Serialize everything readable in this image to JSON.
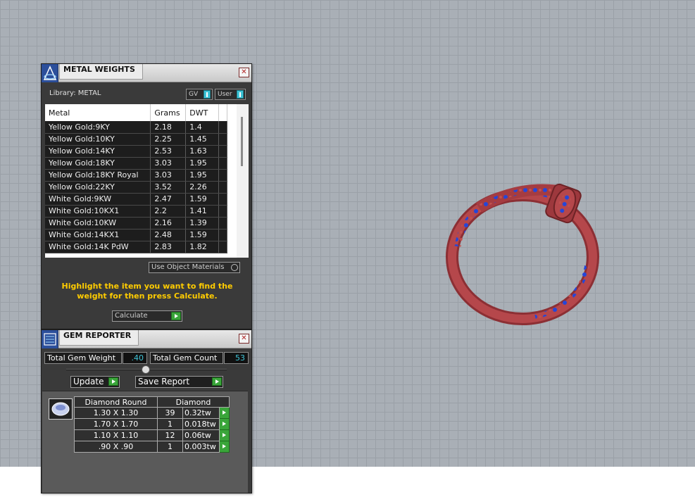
{
  "metal_panel": {
    "title": "METAL WEIGHTS",
    "library_label": "Library: METAL",
    "toggle_gv": "GV",
    "toggle_user": "User",
    "columns": [
      "Metal",
      "Grams",
      "DWT"
    ],
    "rows": [
      [
        "Yellow Gold:9KY",
        "2.18",
        "1.4"
      ],
      [
        "Yellow Gold:10KY",
        "2.25",
        "1.45"
      ],
      [
        "Yellow Gold:14KY",
        "2.53",
        "1.63"
      ],
      [
        "Yellow Gold:18KY",
        "3.03",
        "1.95"
      ],
      [
        "Yellow Gold:18KY Royal",
        "3.03",
        "1.95"
      ],
      [
        "Yellow Gold:22KY",
        "3.52",
        "2.26"
      ],
      [
        "White Gold:9KW",
        "2.47",
        "1.59"
      ],
      [
        "White Gold:10KX1",
        "2.2",
        "1.41"
      ],
      [
        "White Gold:10KW",
        "2.16",
        "1.39"
      ],
      [
        "White Gold:14KX1",
        "2.48",
        "1.59"
      ],
      [
        "White Gold:14K PdW",
        "2.83",
        "1.82"
      ]
    ],
    "use_object_materials": "Use Object Materials",
    "hint": "Highlight the item you want to find the weight for then press Calculate.",
    "calculate_label": "Calculate"
  },
  "gem_panel": {
    "title": "GEM REPORTER",
    "total_weight_label": "Total Gem Weight",
    "total_weight_value": ".40",
    "total_count_label": "Total Gem Count",
    "total_count_value": "53",
    "update_label": "Update",
    "save_report_label": "Save Report",
    "table_headers": [
      "Diamond Round",
      "Diamond"
    ],
    "rows": [
      [
        "1.30 X 1.30",
        "39",
        "0.32tw"
      ],
      [
        "1.70 X 1.70",
        "1",
        "0.018tw"
      ],
      [
        "1.10 X 1.10",
        "12",
        "0.06tw"
      ],
      [
        ".90 X .90",
        "1",
        "0.003tw"
      ]
    ]
  },
  "colors": {
    "ring_metal": "#b5474b",
    "ring_gems": "#2546d8",
    "hint_text": "#ffcc00",
    "accent_cyan": "#3ec3d6",
    "go_green": "#3aa53a"
  }
}
